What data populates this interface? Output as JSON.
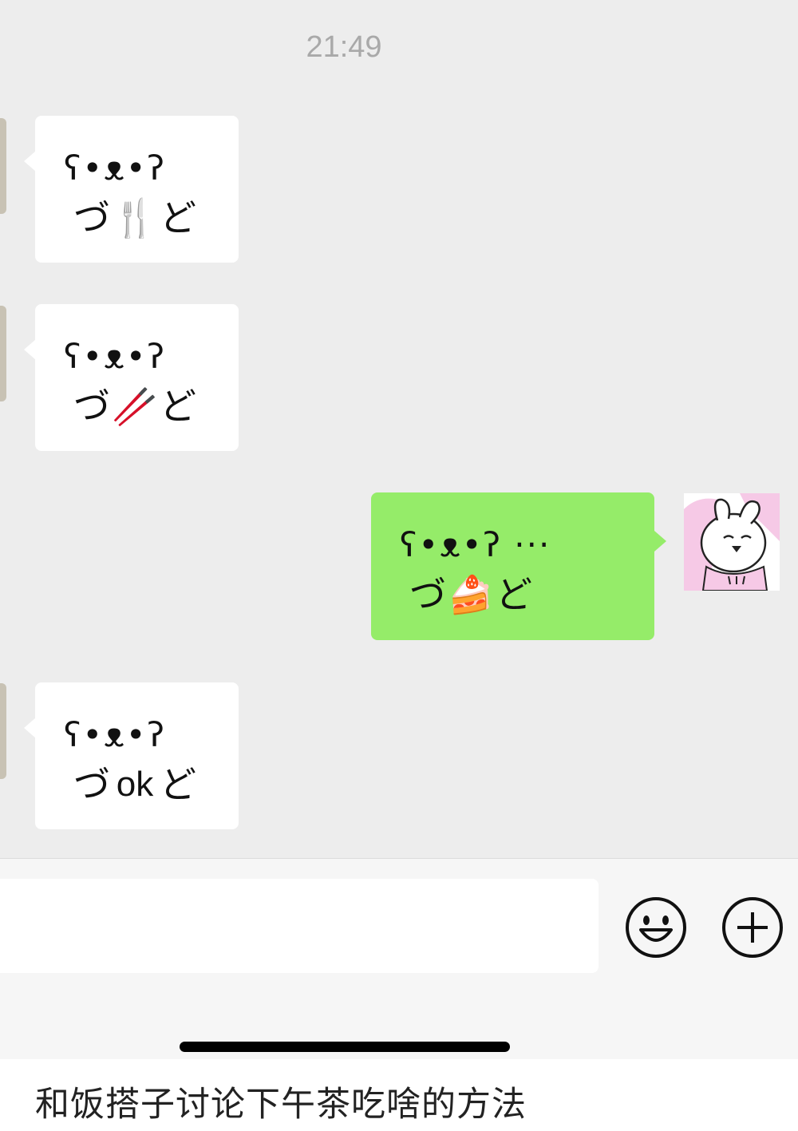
{
  "timestamp": "21:49",
  "messages": [
    {
      "side": "received",
      "face": "ʕ•ᴥ•ʔ",
      "left_arm": "づ",
      "middle": "🍴",
      "middle_icon": "fork-and-knife-icon",
      "right_arm": "ど"
    },
    {
      "side": "received",
      "face": "ʕ•ᴥ•ʔ",
      "left_arm": "づ",
      "middle": "🥢",
      "middle_icon": "chopsticks-icon",
      "right_arm": "ど"
    },
    {
      "side": "sent",
      "face": "ʕ•ᴥ•ʔ ···",
      "left_arm": "づ",
      "middle": "🍰",
      "middle_icon": "cake-icon",
      "right_arm": "ど"
    },
    {
      "side": "received",
      "face": "ʕ•ᴥ•ʔ",
      "left_arm": "づ",
      "middle": "ok",
      "right_arm": "ど"
    }
  ],
  "input_bar": {
    "input_value": "",
    "emoji_icon": "smiley-face-icon",
    "plus_icon": "plus-circle-icon"
  },
  "caption": "和饭搭子讨论下午茶吃啥的方法",
  "colors": {
    "chat_background": "#ededed",
    "sent_bubble": "#95ec69",
    "received_bubble": "#ffffff",
    "timestamp_text": "#a9a9a9"
  }
}
